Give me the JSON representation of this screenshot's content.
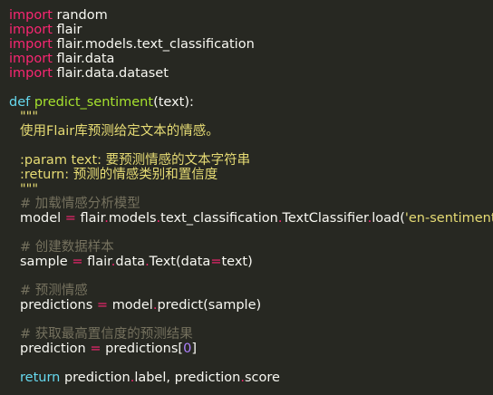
{
  "editor": {
    "imports": [
      {
        "kw": "import",
        "mod": "random"
      },
      {
        "kw": "import",
        "mod": "flair"
      },
      {
        "kw": "import",
        "mod": "flair.models.text_classification"
      },
      {
        "kw": "import",
        "mod": "flair.data"
      },
      {
        "kw": "import",
        "mod": "flair.data.dataset"
      }
    ],
    "def": {
      "kw": "def",
      "name": "predict_sentiment",
      "params": "(text):"
    },
    "docstring": {
      "open": "\"\"\"",
      "summary": "使用Flair库预测给定文本的情感。",
      "param": ":param text: 要预测情感的文本字符串",
      "return": ":return: 预测的情感类别和置信度",
      "close": "\"\"\""
    },
    "comment1": "# 加载情感分析模型",
    "model_line": {
      "lhs": "model",
      "op": "=",
      "rhs_a": "flair",
      "rhs_b": "models",
      "rhs_c": "text_classification",
      "rhs_d": "TextClassifier",
      "rhs_e": "load(",
      "str": "'en-sentiment'",
      "close": ")"
    },
    "comment2": "# 创建数据样本",
    "sample_line": {
      "lhs": "sample",
      "op": "=",
      "rhs_a": "flair",
      "rhs_b": "data",
      "rhs_c": "Text(data",
      "op2": "=",
      "rhs_d": "text)"
    },
    "comment3": "# 预测情感",
    "pred_line": {
      "lhs": "predictions",
      "op": "=",
      "rhs_a": "model",
      "rhs_b": "predict(sample)"
    },
    "comment4": "# 获取最高置信度的预测结果",
    "best_line": {
      "lhs": "prediction",
      "op": "=",
      "rhs_a": "predictions[",
      "num": "0",
      "rhs_b": "]"
    },
    "return_line": {
      "kw": "return",
      "a": "prediction",
      "b": "label",
      "c": ", prediction",
      "d": "score"
    },
    "dot": "."
  }
}
